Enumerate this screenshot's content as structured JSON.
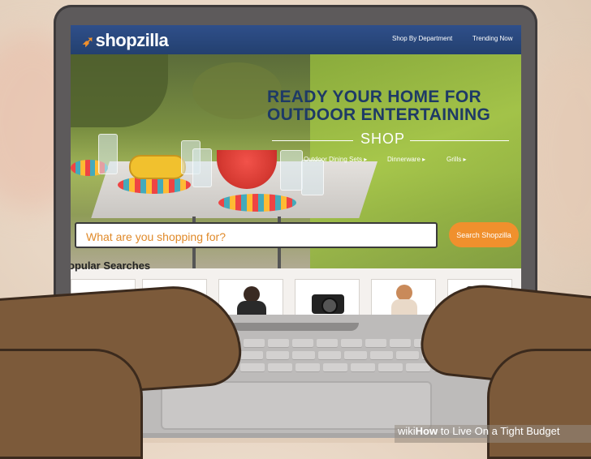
{
  "site": {
    "logo": "shopzilla",
    "nav": [
      "Shop By Department",
      "Trending Now"
    ]
  },
  "hero": {
    "headline_line1": "READY YOUR HOME FOR",
    "headline_line2": "OUTDOOR ENTERTAINING",
    "shop_label": "SHOP",
    "categories": [
      "Outdoor Dining Sets",
      "Dinnerware",
      "Grills"
    ],
    "category_arrow": "▸"
  },
  "search": {
    "placeholder": "What are you shopping for?",
    "button_label": "Search Shopzilla"
  },
  "popular": {
    "title": "opular Searches"
  },
  "watermark": {
    "brand": "wiki",
    "how": "How",
    "title": " to Live On a Tight Budget"
  },
  "colors": {
    "accent_orange": "#f0902d",
    "header_blue": "#2f4f8a",
    "headline_blue": "#1e3a66"
  }
}
